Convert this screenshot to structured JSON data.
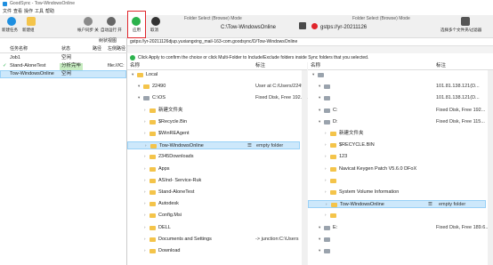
{
  "window": {
    "title": "GoodSync - Tow-WindowsOnline"
  },
  "menu": [
    "文件",
    "查看",
    "操作",
    "工具",
    "帮助"
  ],
  "toolbar": {
    "new_job": "新建任务",
    "new_group": "新建组",
    "account": "帐户同步 关",
    "auto": "自动运行 开",
    "apply": "应用",
    "cancel": "取消",
    "mode_label": "Folder Select (Browse) Mode",
    "left_path": "C:\\Tow-WindowsOnline",
    "right_mode_label": "Folder Select (Browse) Mode",
    "right_path": "gstps://yr-20211126",
    "multi": "选择多个文件夹/过滤器"
  },
  "left_panel": {
    "toggle": "树状视图",
    "cols": [
      "任务名称",
      "状态",
      "路径",
      "左侧路径"
    ],
    "jobs": [
      {
        "name": "Job1",
        "status": "空闲",
        "path": ""
      },
      {
        "name": "Stand-AloneTest",
        "status": "分析完毕",
        "path": "file:///C:"
      },
      {
        "name": "Tow-WindowsOnline",
        "status": "空闲",
        "path": ""
      }
    ]
  },
  "path_bar": "gstps://yr-20211126djup.yuxiangxing_mail-163-com.goodsync/D/Tow-WindowsOnline",
  "info": "Click Apply to confirm the choice or click Multi-Folder to Include/Exclude folders inside Sync folders that you selected.",
  "left_tree": {
    "col1": "名称",
    "col2": "标注",
    "rows": [
      {
        "label": "Local",
        "note": "",
        "indent": 1,
        "kind": "folder"
      },
      {
        "label": "22490",
        "note": "User at C:/Users/22490",
        "indent": 2,
        "kind": "folder"
      },
      {
        "label": "C:\\OS",
        "note": "Fixed Disk, Free 192.3...",
        "indent": 2,
        "kind": "drive"
      },
      {
        "label": "新建文件夹",
        "note": "",
        "indent": 3,
        "kind": "folder"
      },
      {
        "label": "$Recycle.Bin",
        "note": "",
        "indent": 3,
        "kind": "folder"
      },
      {
        "label": "$WinREAgent",
        "note": "",
        "indent": 3,
        "kind": "folder"
      },
      {
        "label": "Tow-WindowsOnline",
        "note": "empty folder",
        "indent": 3,
        "kind": "folder",
        "selected": true
      },
      {
        "label": "2345Downloads",
        "note": "",
        "indent": 3,
        "kind": "folder"
      },
      {
        "label": "Apps",
        "note": "",
        "indent": 3,
        "kind": "folder"
      },
      {
        "label": "ASInd- Service-Ruk",
        "note": "",
        "indent": 3,
        "kind": "folder"
      },
      {
        "label": "Stand-AloneTest",
        "note": "",
        "indent": 3,
        "kind": "folder"
      },
      {
        "label": "Autodesk",
        "note": "",
        "indent": 3,
        "kind": "folder"
      },
      {
        "label": "Config.Msi",
        "note": "",
        "indent": 3,
        "kind": "folder"
      },
      {
        "label": "DELL",
        "note": "",
        "indent": 3,
        "kind": "folder"
      },
      {
        "label": "Documents and Settings",
        "note": "-> junction:C:\\Users",
        "indent": 3,
        "kind": "folder"
      },
      {
        "label": "Download",
        "note": "",
        "indent": 3,
        "kind": "folder"
      }
    ]
  },
  "right_tree": {
    "col1": "名称",
    "col2": "标注",
    "rows": [
      {
        "label": "",
        "note": "",
        "indent": 1,
        "kind": "drive"
      },
      {
        "label": "",
        "note": "101.81.138.121(D...",
        "indent": 2,
        "kind": "drive"
      },
      {
        "label": "",
        "note": "101.81.138.121(D...",
        "indent": 2,
        "kind": "drive"
      },
      {
        "label": "C:",
        "note": "Fixed Disk, Free 192...",
        "indent": 2,
        "kind": "drive"
      },
      {
        "label": "D:",
        "note": "Fixed Disk, Free 115...",
        "indent": 2,
        "kind": "drive"
      },
      {
        "label": "新建文件夹",
        "note": "",
        "indent": 3,
        "kind": "folder"
      },
      {
        "label": "$RECYCLE.BIN",
        "note": "",
        "indent": 3,
        "kind": "folder"
      },
      {
        "label": "123",
        "note": "",
        "indent": 3,
        "kind": "folder"
      },
      {
        "label": "Navicat Keygen Patch V5.6.0 DFoX",
        "note": "",
        "indent": 3,
        "kind": "folder"
      },
      {
        "label": "",
        "note": "",
        "indent": 3,
        "kind": "folder"
      },
      {
        "label": "System Volume Information",
        "note": "",
        "indent": 3,
        "kind": "folder"
      },
      {
        "label": "Tow-WindowsOnline",
        "note": "empty folder",
        "indent": 3,
        "kind": "folder",
        "selected": true
      },
      {
        "label": "",
        "note": "",
        "indent": 3,
        "kind": "folder"
      },
      {
        "label": "E:",
        "note": "Fixed Disk, Free 189.6...",
        "indent": 2,
        "kind": "drive"
      },
      {
        "label": "",
        "note": "",
        "indent": 2,
        "kind": "drive"
      },
      {
        "label": "",
        "note": "",
        "indent": 2,
        "kind": "drive"
      }
    ]
  },
  "colors": {
    "accent": "#1e8fe0",
    "selected_row": "#cde8fb",
    "apply_green": "#2bb24c",
    "highlight_red": "#e0252b",
    "status_green": "#c7ecc1"
  }
}
